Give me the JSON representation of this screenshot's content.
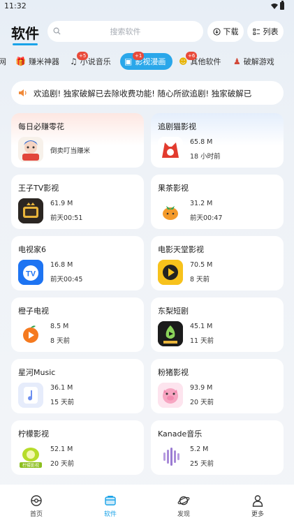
{
  "status": {
    "time": "11:32"
  },
  "header": {
    "title": "软件",
    "search_placeholder": "搜索软件",
    "download_label": "下载",
    "list_label": "列表"
  },
  "categories": [
    {
      "label": "网",
      "icon": "globe-icon",
      "badge": ""
    },
    {
      "label": "赚米神器",
      "icon": "gift-icon",
      "badge": ""
    },
    {
      "label": "小说音乐",
      "icon": "music-note-icon",
      "badge": "+5"
    },
    {
      "label": "影视漫画",
      "icon": "tv-icon",
      "badge": "+1",
      "active": true
    },
    {
      "label": "其他软件",
      "icon": "smile-icon",
      "badge": "+6"
    },
    {
      "label": "破解游戏",
      "icon": "joystick-icon",
      "badge": ""
    }
  ],
  "notice": {
    "text": "欢追剧!    独家破解已去除收费功能!  随心所欲追剧!    独家破解已"
  },
  "apps": [
    {
      "name": "每日必赚零花",
      "single": "倒卖叮当赚米",
      "icon": "comic-girl-icon",
      "bg": "pink"
    },
    {
      "name": "追剧猫影视",
      "size": "65.8 M",
      "time": "18 小时前",
      "icon": "cat-logo-icon",
      "bg": "blue"
    },
    {
      "name": "王子TV影视",
      "size": "61.9 M",
      "time": "前天00:51",
      "icon": "crowned-tv-icon"
    },
    {
      "name": "果茶影视",
      "size": "31.2 M",
      "time": "前天00:47",
      "icon": "fruit-tea-icon"
    },
    {
      "name": "电视家6",
      "size": "16.8 M",
      "time": "前天00:45",
      "icon": "tv-bubble-icon"
    },
    {
      "name": "电影天堂影视",
      "size": "70.5 M",
      "time": "8 天前",
      "icon": "play-clapper-icon"
    },
    {
      "name": "橙子电视",
      "size": "8.5 M",
      "time": "8 天前",
      "icon": "orange-play-icon"
    },
    {
      "name": "东梨短剧",
      "size": "45.1 M",
      "time": "11 天前",
      "icon": "pear-drama-icon"
    },
    {
      "name": "星河Music",
      "size": "36.1 M",
      "time": "15 天前",
      "icon": "music-note-card-icon"
    },
    {
      "name": "粉猪影视",
      "size": "93.9 M",
      "time": "20 天前",
      "icon": "pink-pig-icon"
    },
    {
      "name": "柠檬影视",
      "size": "52.1 M",
      "time": "20 天前",
      "icon": "lemon-icon",
      "icon_text": "柠檬影视"
    },
    {
      "name": "Kanade音乐",
      "size": "5.2 M",
      "time": "25 天前",
      "icon": "sound-wave-icon"
    }
  ],
  "nav": [
    {
      "label": "首页",
      "icon": "home-ball-icon"
    },
    {
      "label": "软件",
      "icon": "software-box-icon",
      "active": true
    },
    {
      "label": "发现",
      "icon": "planet-icon"
    },
    {
      "label": "更多",
      "icon": "person-icon"
    }
  ],
  "colors": {
    "accent": "#1aa3e8",
    "badge": "#e94a3a"
  }
}
